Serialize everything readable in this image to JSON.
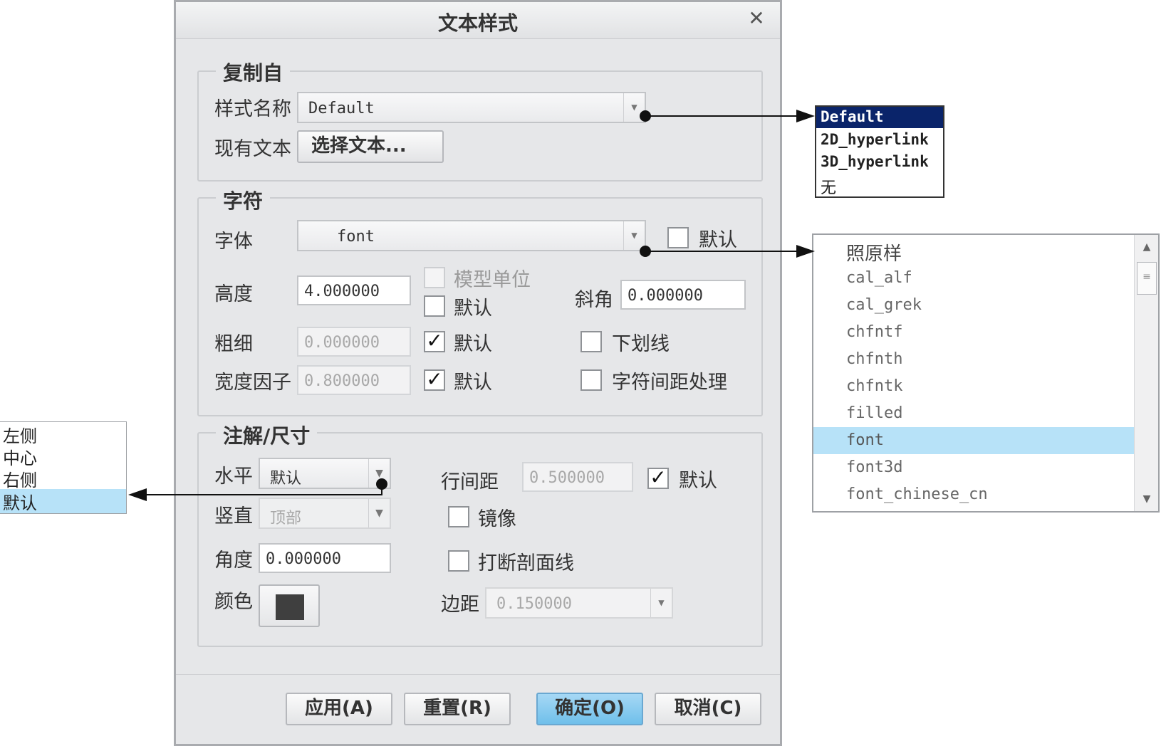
{
  "dialog": {
    "title": "文本样式",
    "close_icon": "close-icon",
    "copy_from": {
      "legend": "复制自",
      "style_name_label": "样式名称",
      "style_name_value": "Default",
      "existing_text_label": "现有文本",
      "select_text_button": "选择文本..."
    },
    "character": {
      "legend": "字符",
      "font_label": "字体",
      "font_value": "font",
      "font_default_label": "默认",
      "font_default_checked": false,
      "height_label": "高度",
      "height_value": "4.000000",
      "model_units_label": "模型单位",
      "model_units_checked": false,
      "height_default_label": "默认",
      "height_default_checked": false,
      "slant_label": "斜角",
      "slant_value": "0.000000",
      "thickness_label": "粗细",
      "thickness_value": "0.000000",
      "thickness_default_label": "默认",
      "thickness_default_checked": true,
      "underline_label": "下划线",
      "underline_checked": false,
      "width_factor_label": "宽度因子",
      "width_factor_value": "0.800000",
      "width_default_label": "默认",
      "width_default_checked": true,
      "kerning_label": "字符间距处理",
      "kerning_checked": false
    },
    "note_dim": {
      "legend": "注解/尺寸",
      "horizontal_label": "水平",
      "horizontal_value": "默认",
      "vertical_label": "竖直",
      "vertical_value": "顶部",
      "angle_label": "角度",
      "angle_value": "0.000000",
      "color_label": "颜色",
      "color_value": "#3f3f3f",
      "line_spacing_label": "行间距",
      "line_spacing_value": "0.500000",
      "line_spacing_default_label": "默认",
      "line_spacing_default_checked": true,
      "mirror_label": "镜像",
      "mirror_checked": false,
      "break_hatch_label": "打断剖面线",
      "break_hatch_checked": false,
      "margin_label": "边距",
      "margin_value": "0.150000"
    },
    "buttons": {
      "apply": "应用(A)",
      "reset": "重置(R)",
      "ok": "确定(O)",
      "cancel": "取消(C)"
    }
  },
  "style_name_list": {
    "items": [
      "Default",
      "2D_hyperlink",
      "3D_hyperlink",
      "无"
    ],
    "selected": "Default"
  },
  "font_list": {
    "items": [
      "照原样",
      "cal_alf",
      "cal_grek",
      "chfntf",
      "chfnth",
      "chfntk",
      "filled",
      "font",
      "font3d",
      "font_chinese_cn"
    ],
    "selected": "font"
  },
  "horizontal_list": {
    "items": [
      "左侧",
      "中心",
      "右侧",
      "默认"
    ],
    "selected": "默认"
  }
}
